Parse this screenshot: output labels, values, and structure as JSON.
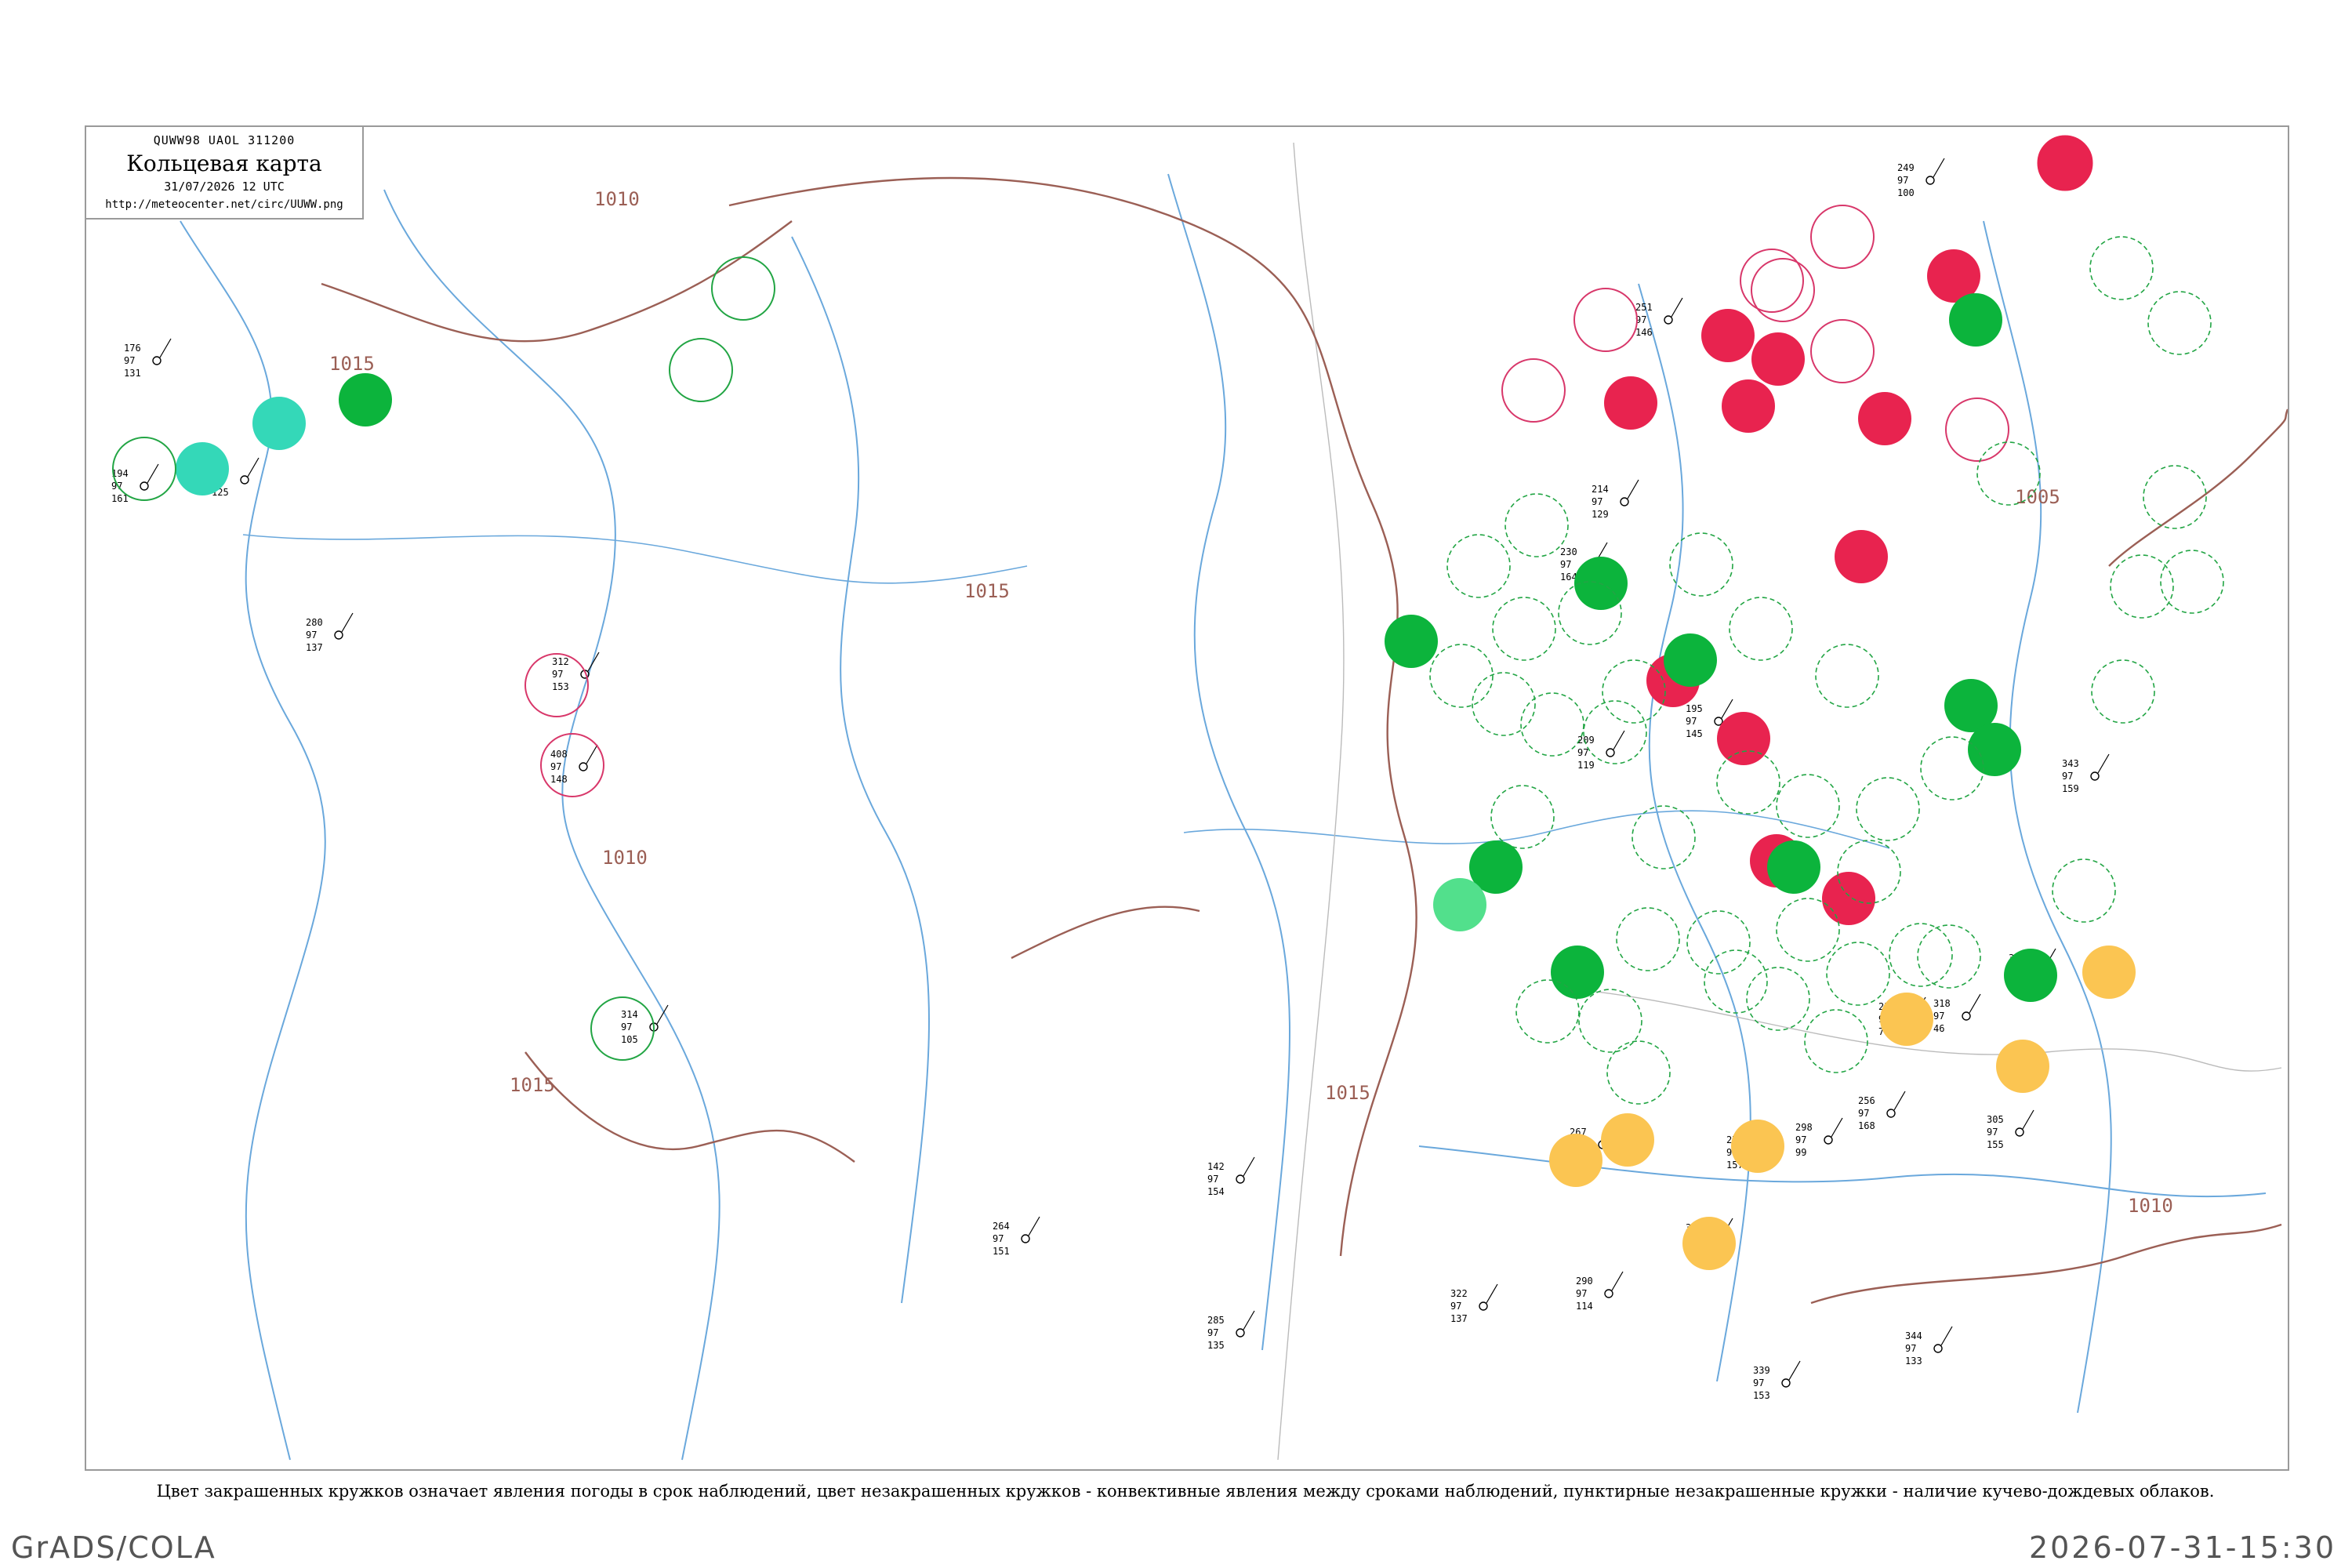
{
  "header": {
    "code_line": "QUWW98  UAOL  311200",
    "title": "Кольцевая карта",
    "datetime": "31/07/2026 12 UTC",
    "url": "http://meteocenter.net/circ/UUWW.png"
  },
  "caption": "Цвет закрашенных кружков означает явления погоды в срок наблюдений, цвет незакрашенных кружков - конвективные явления между сроками наблюдений, пунктирные незакрашенные кружки - наличие кучево-дождевых облаков.",
  "footer": {
    "left": "GrADS/COLA",
    "right": "2026-07-31-15:30"
  },
  "colors": {
    "thunderstorm": "#e8234f",
    "rain": "#0cb43c",
    "shower": "#34d8b8",
    "haze": "#fbc552",
    "cb_dashed": "#22a544",
    "river": "#6aa8dc",
    "isobar": "#9b5f55"
  },
  "isobar_labels": [
    {
      "id": "lbl-1010-a",
      "text": "1010"
    },
    {
      "id": "lbl-1015-a",
      "text": "1015"
    },
    {
      "id": "lbl-1010-b",
      "text": "1010"
    },
    {
      "id": "lbl-1015-b",
      "text": "1015"
    },
    {
      "id": "lbl-1015-c",
      "text": "1015"
    },
    {
      "id": "lbl-1005",
      "text": "1005"
    },
    {
      "id": "lbl-1010-c",
      "text": "1010"
    },
    {
      "id": "lbl-1015-d",
      "text": "1015"
    }
  ],
  "stations": [
    {
      "id": "s1",
      "t": "176",
      "p": "97",
      "v": "131"
    },
    {
      "id": "s2",
      "t": "153",
      "p": "97",
      "v": "125"
    },
    {
      "id": "s3",
      "t": "194",
      "p": "97",
      "v": "161"
    },
    {
      "id": "s4",
      "t": "280",
      "p": "97",
      "v": "137"
    },
    {
      "id": "s5",
      "t": "312",
      "p": "97",
      "v": "153"
    },
    {
      "id": "s6",
      "t": "408",
      "p": "97",
      "v": "148"
    },
    {
      "id": "s7",
      "t": "314",
      "p": "97",
      "v": "105"
    },
    {
      "id": "s8",
      "t": "214",
      "p": "97",
      "v": "129"
    },
    {
      "id": "s9",
      "t": "230",
      "p": "97",
      "v": "164"
    },
    {
      "id": "s10",
      "t": "209",
      "p": "97",
      "v": "119"
    },
    {
      "id": "s11",
      "t": "251",
      "p": "97",
      "v": "146"
    },
    {
      "id": "s12",
      "t": "249",
      "p": "97",
      "v": "100"
    },
    {
      "id": "s13",
      "t": "298",
      "p": "97",
      "v": "99"
    },
    {
      "id": "s14",
      "t": "304",
      "p": "97",
      "v": "136"
    },
    {
      "id": "s15",
      "t": "318",
      "p": "97",
      "v": "46"
    },
    {
      "id": "s16",
      "t": "301",
      "p": "97",
      "v": "67"
    },
    {
      "id": "s17",
      "t": "258",
      "p": "97",
      "v": "79"
    },
    {
      "id": "s18",
      "t": "267",
      "p": "97",
      "v": "113"
    },
    {
      "id": "s19",
      "t": "195",
      "p": "97",
      "v": "145"
    },
    {
      "id": "s20",
      "t": "343",
      "p": "97",
      "v": "159"
    },
    {
      "id": "s21",
      "t": "270",
      "p": "97",
      "v": "157"
    },
    {
      "id": "s22",
      "t": "305",
      "p": "97",
      "v": "155"
    },
    {
      "id": "s23",
      "t": "256",
      "p": "97",
      "v": "168"
    },
    {
      "id": "s24",
      "t": "142",
      "p": "97",
      "v": "154"
    },
    {
      "id": "s25",
      "t": "285",
      "p": "97",
      "v": "135"
    },
    {
      "id": "s26",
      "t": "322",
      "p": "97",
      "v": "137"
    },
    {
      "id": "s27",
      "t": "290",
      "p": "97",
      "v": "114"
    },
    {
      "id": "s28",
      "t": "339",
      "p": "97",
      "v": "153"
    },
    {
      "id": "s29",
      "t": "344",
      "p": "97",
      "v": "133"
    },
    {
      "id": "s30",
      "t": "264",
      "p": "97",
      "v": "151"
    }
  ]
}
